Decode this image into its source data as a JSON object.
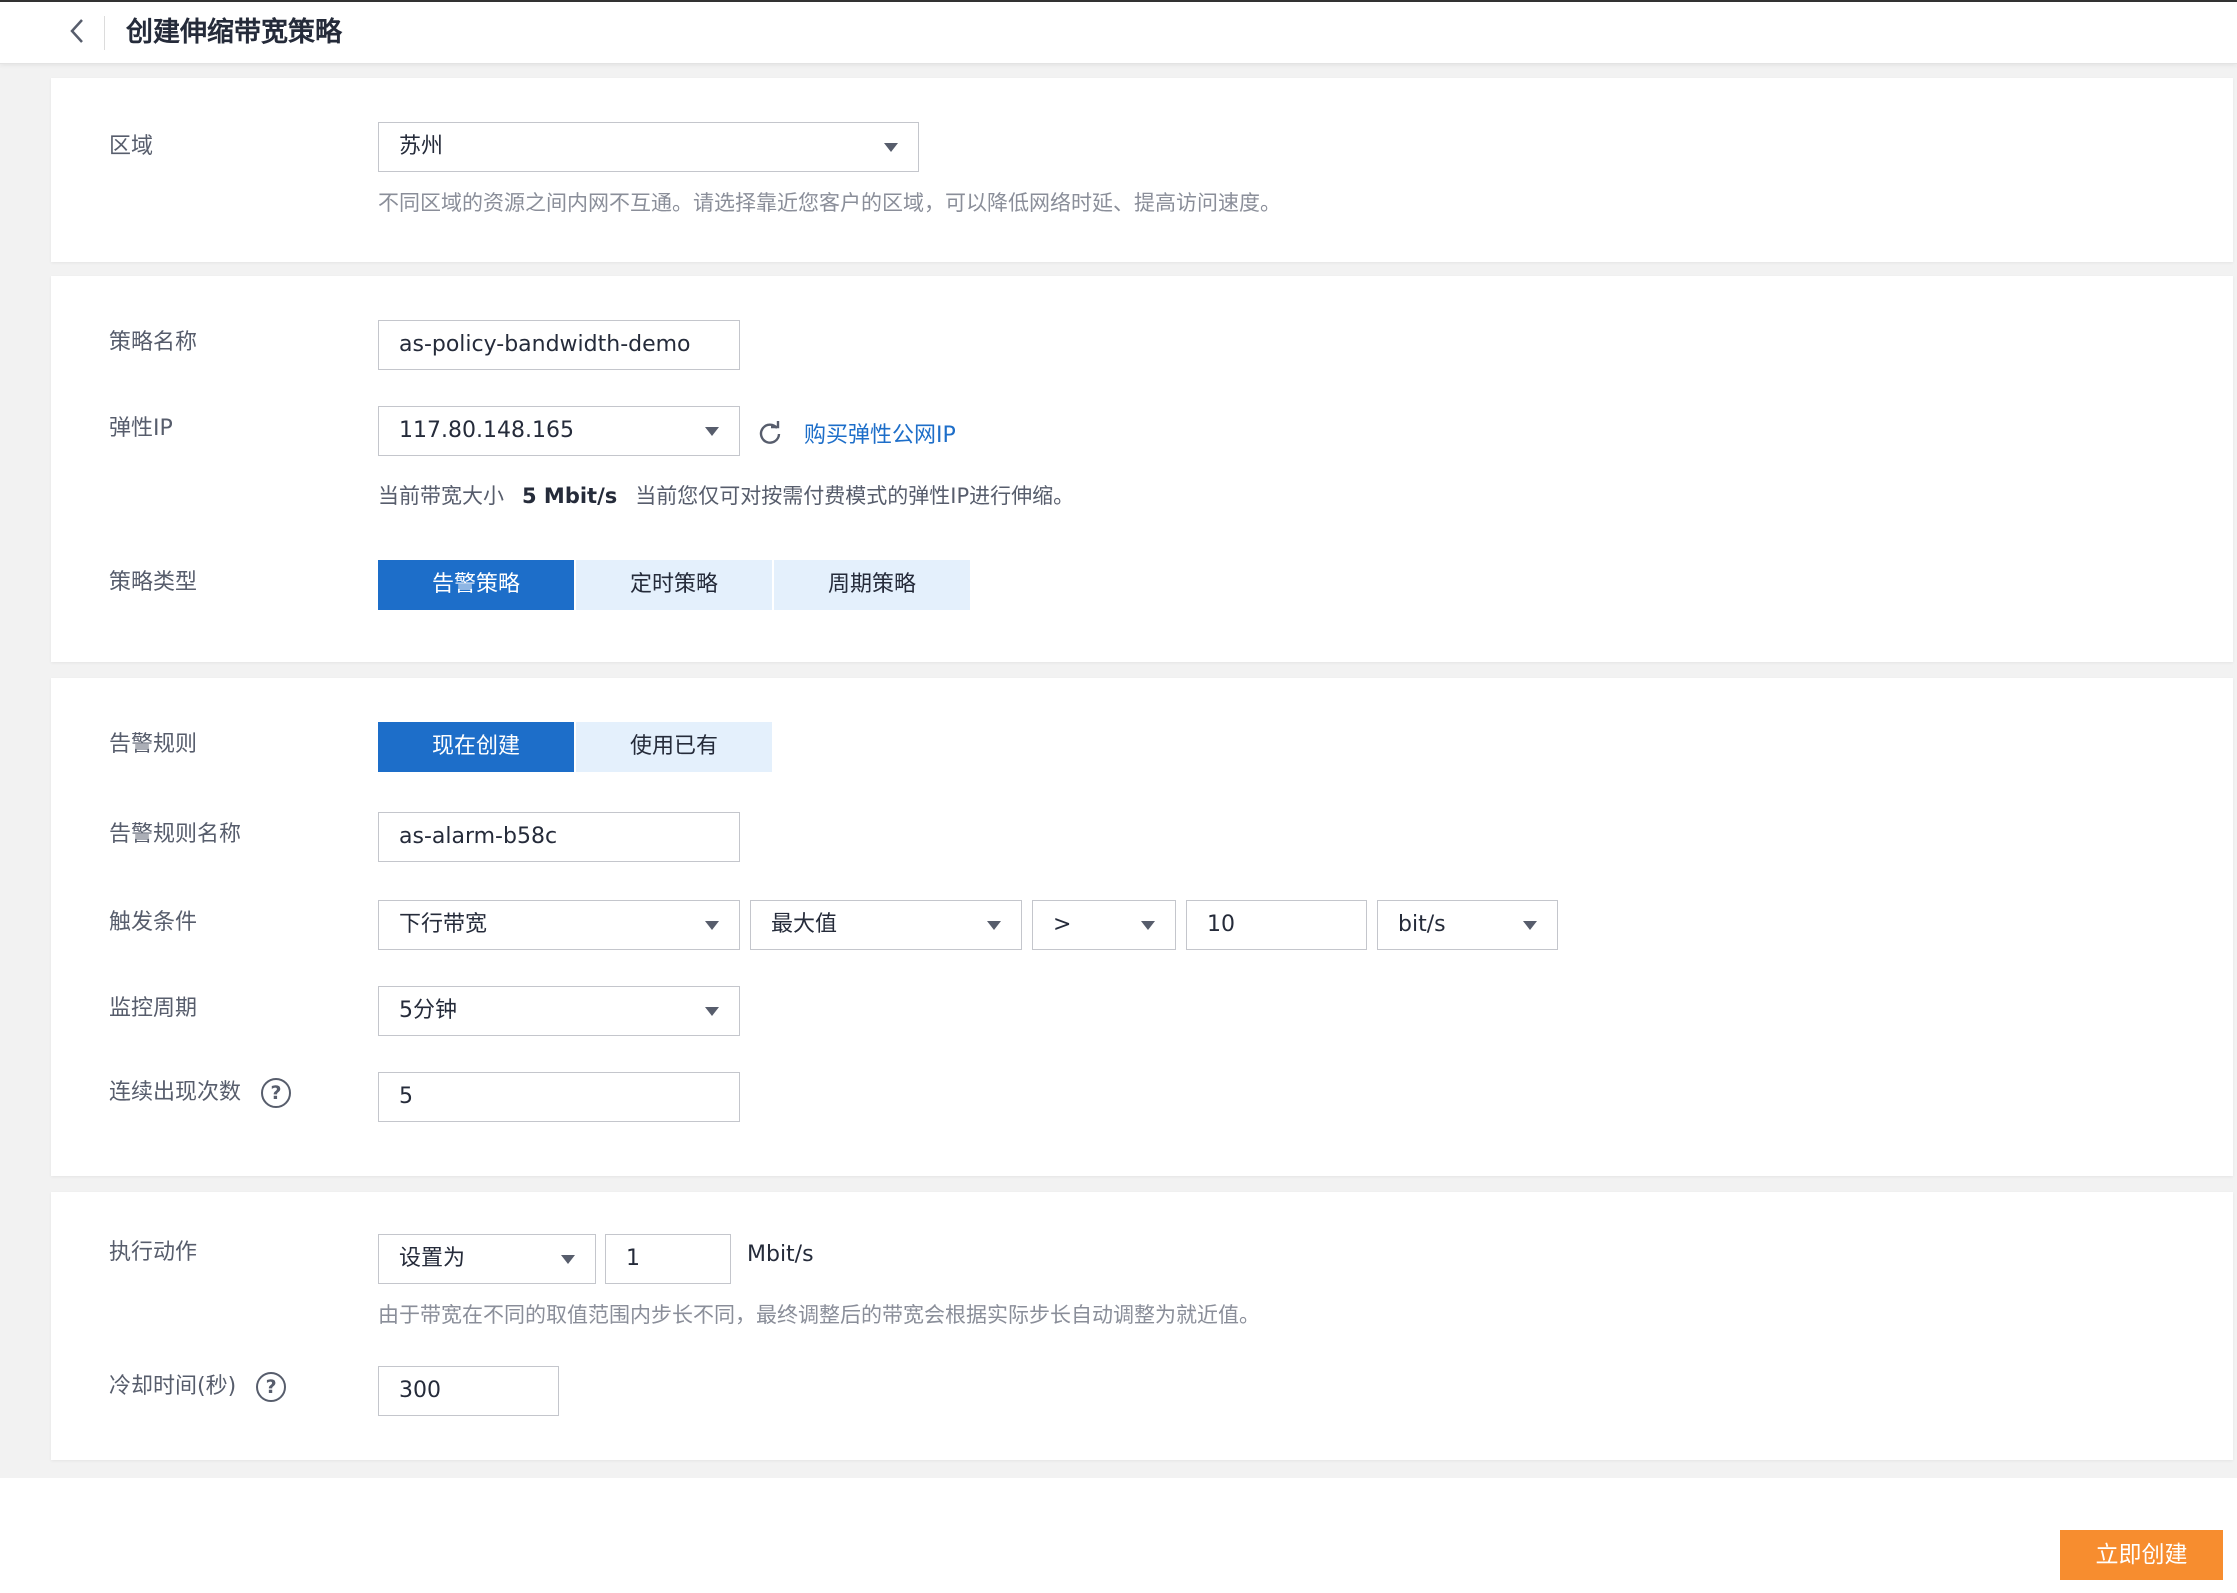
{
  "header": {
    "title": "创建伸缩带宽策略"
  },
  "region": {
    "label": "区域",
    "value": "苏州",
    "hint": "不同区域的资源之间内网不互通。请选择靠近您客户的区域，可以降低网络时延、提高访问速度。"
  },
  "policy": {
    "name_label": "策略名称",
    "name_value": "as-policy-bandwidth-demo",
    "eip_label": "弹性IP",
    "eip_value": "117.80.148.165",
    "buy_eip_link": "购买弹性公网IP",
    "bandwidth_prefix": "当前带宽大小",
    "bandwidth_value": "5 Mbit/s",
    "bandwidth_note": "当前您仅可对按需付费模式的弹性IP进行伸缩。",
    "type_label": "策略类型",
    "types": [
      "告警策略",
      "定时策略",
      "周期策略"
    ],
    "active_type": "告警策略"
  },
  "alarm": {
    "rule_label": "告警规则",
    "rule_options": [
      "现在创建",
      "使用已有"
    ],
    "active_rule": "现在创建",
    "rule_name_label": "告警规则名称",
    "rule_name_value": "as-alarm-b58c",
    "trigger_label": "触发条件",
    "trigger_metric": "下行带宽",
    "trigger_stat": "最大值",
    "trigger_op": ">",
    "trigger_threshold": "10",
    "trigger_unit": "bit/s",
    "period_label": "监控周期",
    "period_value": "5分钟",
    "count_label": "连续出现次数",
    "count_value": "5"
  },
  "action": {
    "label": "执行动作",
    "op_value": "设置为",
    "amount_value": "1",
    "unit": "Mbit/s",
    "hint": "由于带宽在不同的取值范围内步长不同，最终调整后的带宽会根据实际步长自动调整为就近值。",
    "cooldown_label": "冷却时间(秒)",
    "cooldown_value": "300"
  },
  "footer": {
    "create_label": "立即创建"
  },
  "colors": {
    "primary": "#1d6ec9",
    "create_button": "#f78d2f"
  }
}
